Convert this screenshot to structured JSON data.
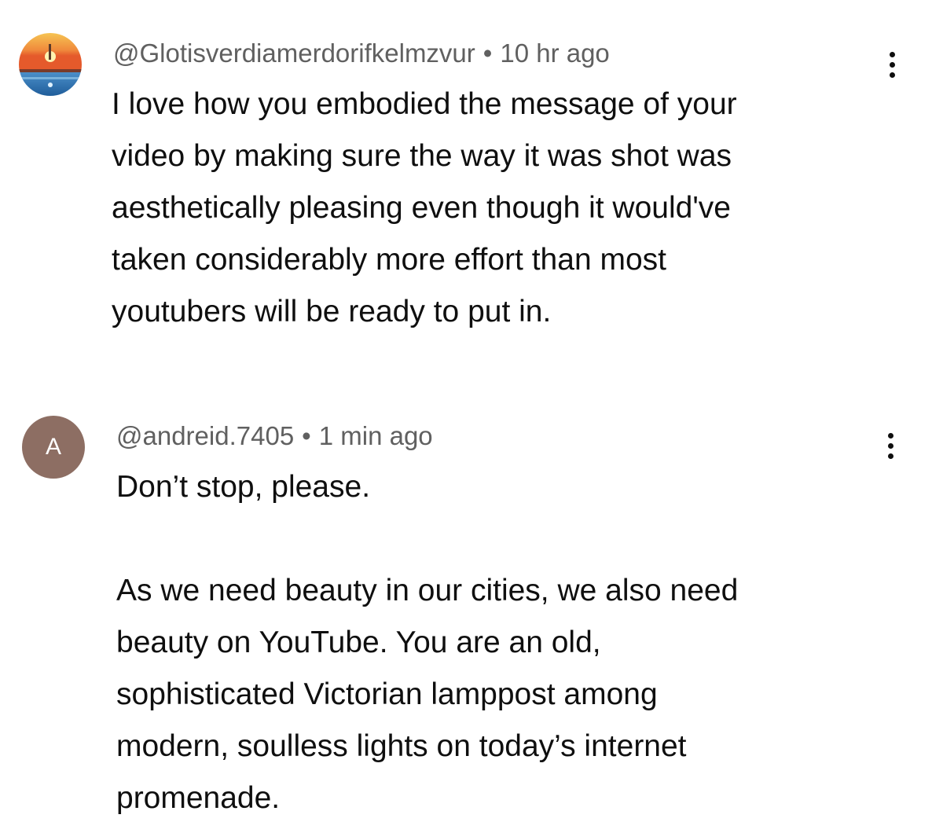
{
  "comments": [
    {
      "username": "@Glotisverdiamerdorifkelmzvur",
      "separator": "•",
      "time": "10 hr ago",
      "avatar_icon": "sunset-landscape-avatar",
      "text": "I love how you embodied the message of your\nvideo by making sure the way it was shot was\naesthetically pleasing even though it would've\ntaken considerably more effort than most\nyoutubers will be ready to put in."
    },
    {
      "username": "@andreid.7405",
      "separator": "•",
      "time": "1 min ago",
      "avatar_letter": "A",
      "avatar_color": "#8d6e63",
      "text": "Don’t stop, please.\n\nAs we need beauty in our cities, we also need\nbeauty on YouTube. You are an old,\nsophisticated Victorian lamppost among\nmodern, soulless lights on today’s internet\npromenade."
    }
  ],
  "menu_icon": "more-vertical-icon"
}
